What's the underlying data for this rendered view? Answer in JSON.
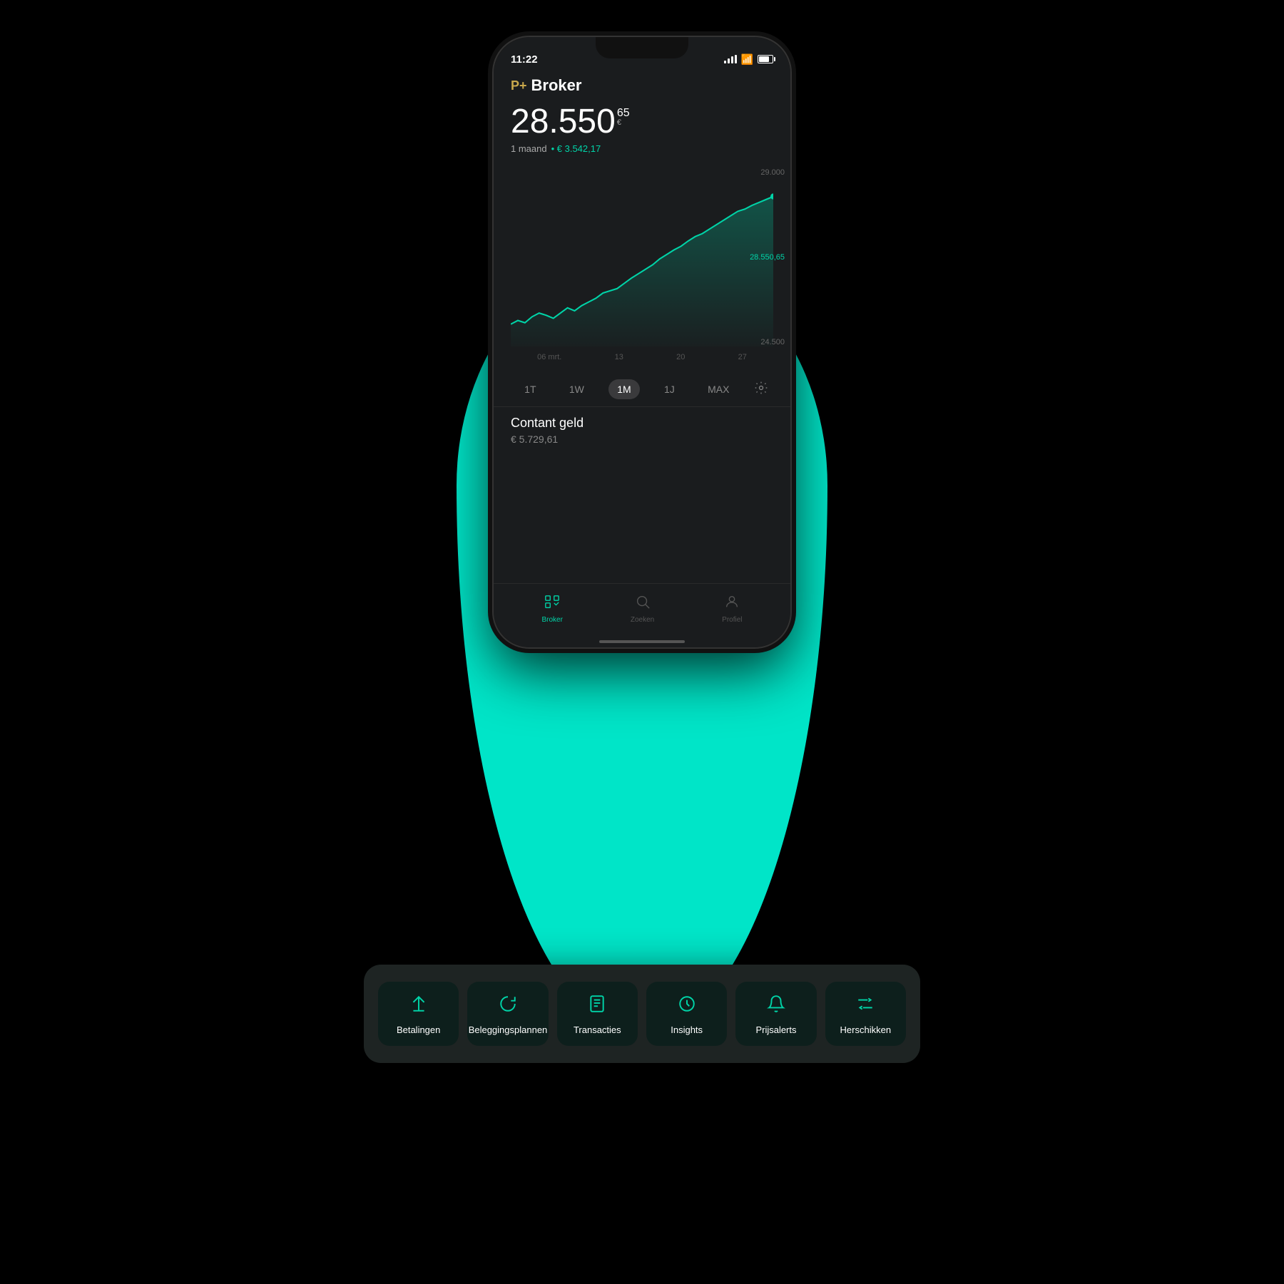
{
  "status_bar": {
    "time": "11:22"
  },
  "header": {
    "logo": "P+",
    "title": "Broker"
  },
  "portfolio": {
    "value_main": "28.550",
    "value_decimals": "65",
    "value_currency": "€",
    "period_label": "1 maand",
    "period_gain": "• € 3.542,17",
    "chart_max_label": "29.000",
    "chart_current_label": "28.550,65",
    "chart_min_label": "24.500",
    "chart_dates": [
      "06 mrt.",
      "13",
      "20",
      "27"
    ]
  },
  "period_selector": {
    "buttons": [
      "1T",
      "1W",
      "1M",
      "1J",
      "MAX"
    ],
    "active": "1M"
  },
  "action_buttons": [
    {
      "id": "betalingen",
      "label": "Betalingen",
      "icon": "upload"
    },
    {
      "id": "beleggingsplannen",
      "label": "Beleggingsplannen",
      "icon": "refresh"
    },
    {
      "id": "transacties",
      "label": "Transacties",
      "icon": "document"
    },
    {
      "id": "insights",
      "label": "Insights",
      "icon": "circle-o"
    },
    {
      "id": "prijsalerts",
      "label": "Prijsalerts",
      "icon": "bell"
    },
    {
      "id": "herschikken",
      "label": "Herschikken",
      "icon": "reorder"
    }
  ],
  "cash": {
    "label": "Contant geld",
    "value": "€ 5.729,61"
  },
  "bottom_nav": [
    {
      "id": "broker",
      "label": "Broker",
      "active": true
    },
    {
      "id": "zoeken",
      "label": "Zoeken",
      "active": false
    },
    {
      "id": "profiel",
      "label": "Profiel",
      "active": false
    }
  ],
  "colors": {
    "teal": "#00e5c8",
    "accent": "#00d4a8",
    "bg_dark": "#1a1c1e",
    "bg_panel": "#0d1f1c"
  }
}
